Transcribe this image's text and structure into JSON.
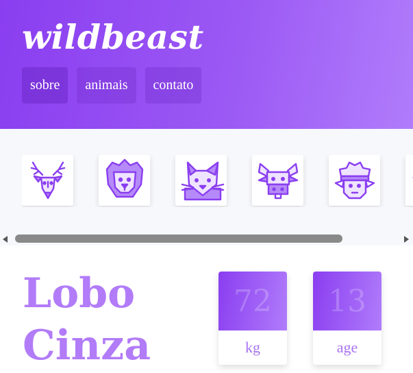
{
  "brand": "wildbeast",
  "nav": [
    {
      "label": "sobre"
    },
    {
      "label": "animais"
    },
    {
      "label": "contato"
    }
  ],
  "animals": [
    {
      "icon": "deer-icon"
    },
    {
      "icon": "lion-icon"
    },
    {
      "icon": "cat-icon"
    },
    {
      "icon": "bull-icon"
    },
    {
      "icon": "sheep-icon"
    }
  ],
  "detail": {
    "title_line1": "Lobo",
    "title_line2": "Cinza",
    "stats": [
      {
        "value": "72",
        "label": "kg"
      },
      {
        "value": "13",
        "label": "age"
      }
    ]
  },
  "colors": {
    "accent": "#8a3ef0",
    "accent_light": "#b07cfb",
    "title": "#b27cf8",
    "icon_stroke": "#8a3ef0",
    "icon_fill": "#b58af8"
  }
}
